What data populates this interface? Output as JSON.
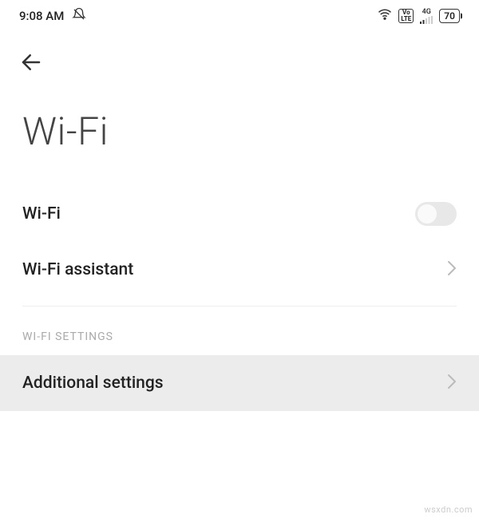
{
  "statusbar": {
    "time": "9:08 AM",
    "network_label": "4G",
    "volte_top": "Vo",
    "volte_bottom": "LTE",
    "battery": "70"
  },
  "page": {
    "title": "Wi-Fi"
  },
  "rows": {
    "wifi_toggle": {
      "label": "Wi-Fi",
      "enabled": false
    },
    "wifi_assistant": {
      "label": "Wi-Fi assistant"
    },
    "section_header": "WI-FI SETTINGS",
    "additional": {
      "label": "Additional settings"
    }
  },
  "watermark": "wsxdn.com"
}
